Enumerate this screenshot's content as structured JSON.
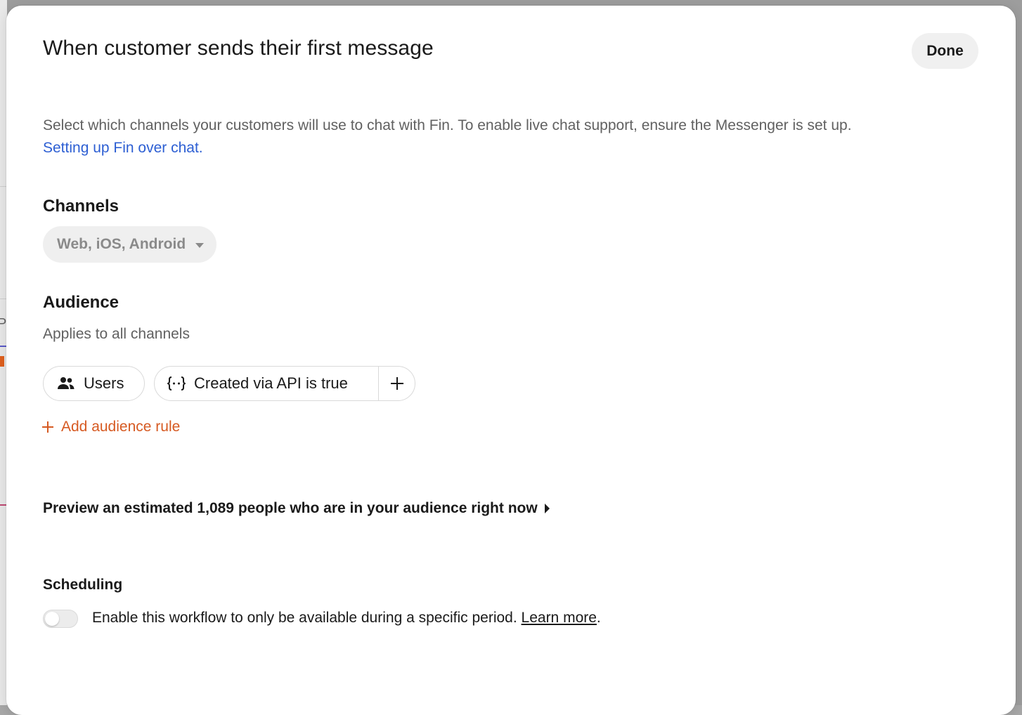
{
  "modal": {
    "title": "When customer sends their first message",
    "done_label": "Done",
    "description": "Select which channels your customers will use to chat with Fin. To enable live chat support, ensure the Messenger is set up.",
    "description_link": "Setting up Fin over chat."
  },
  "channels": {
    "heading": "Channels",
    "selected": "Web, iOS, Android"
  },
  "audience": {
    "heading": "Audience",
    "subtext": "Applies to all channels",
    "users_pill": "Users",
    "rule_pill": "Created via API is true",
    "add_rule_label": "Add audience rule",
    "preview_label": "Preview an estimated 1,089 people who are in your audience right now"
  },
  "scheduling": {
    "heading": "Scheduling",
    "toggle_on": false,
    "text": "Enable this workflow to only be available during a specific period.",
    "learn_more": "Learn more",
    "trailing": "."
  },
  "colors": {
    "link_blue": "#2d5fd3",
    "accent_orange": "#d65a22"
  },
  "icons": {
    "users_pill": "users-icon",
    "rule_pill": "attribute-braces-icon",
    "channels": "chevron-down-icon",
    "preview": "caret-right-icon"
  }
}
